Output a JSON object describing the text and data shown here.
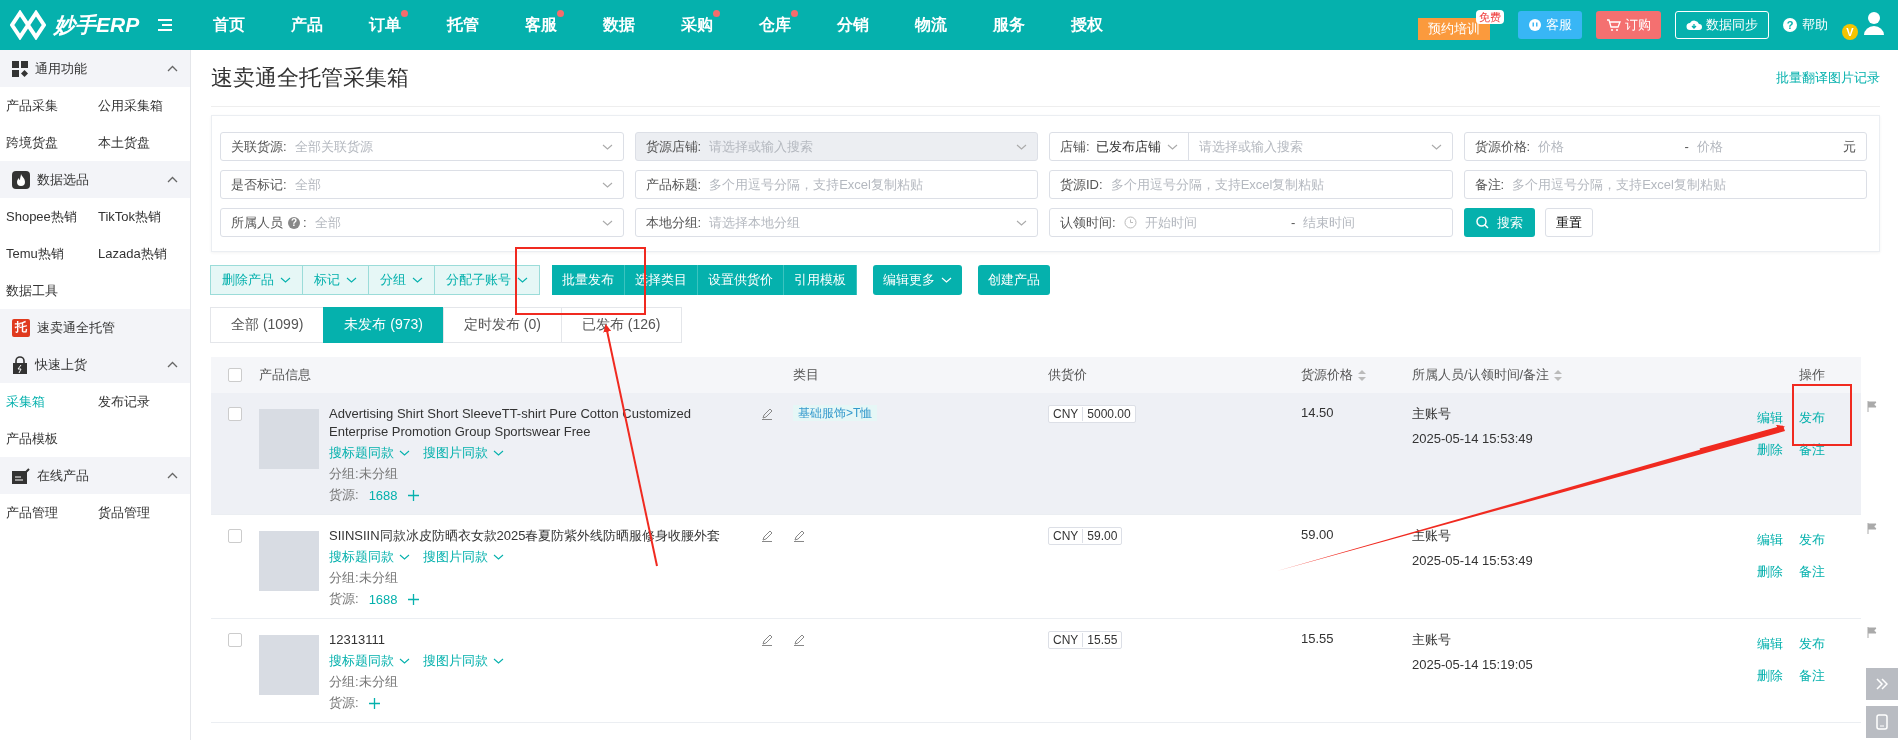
{
  "brand": {
    "name": "妙手ERP"
  },
  "nav": [
    {
      "label": "首页",
      "badge": false
    },
    {
      "label": "产品",
      "badge": false
    },
    {
      "label": "订单",
      "badge": true
    },
    {
      "label": "托管",
      "badge": false
    },
    {
      "label": "客服",
      "badge": true
    },
    {
      "label": "数据",
      "badge": false
    },
    {
      "label": "采购",
      "badge": true
    },
    {
      "label": "仓库",
      "badge": true
    },
    {
      "label": "分销",
      "badge": false
    },
    {
      "label": "物流",
      "badge": false
    },
    {
      "label": "服务",
      "badge": false
    },
    {
      "label": "授权",
      "badge": false
    }
  ],
  "header_actions": [
    {
      "kind": "training",
      "label": "预约培训",
      "tag": "免费"
    },
    {
      "kind": "service",
      "label": "客服"
    },
    {
      "kind": "order",
      "label": "订购"
    },
    {
      "kind": "sync",
      "label": "数据同步"
    },
    {
      "kind": "help",
      "label": "帮助",
      "icon_text": "?"
    }
  ],
  "avatar": {
    "badge": "V"
  },
  "sidebar": [
    {
      "title": "通用功能",
      "expanded": true,
      "items": [
        {
          "label": "产品采集",
          "selected": false
        },
        {
          "label": "公用采集箱",
          "selected": false
        },
        {
          "label": "跨境货盘",
          "selected": false
        },
        {
          "label": "本土货盘",
          "selected": false
        }
      ]
    },
    {
      "title": "数据选品",
      "expanded": true,
      "items": [
        {
          "label": "Shopee热销",
          "selected": false
        },
        {
          "label": "TikTok热销",
          "selected": false
        },
        {
          "label": "Temu热销",
          "selected": false
        },
        {
          "label": "Lazada热销",
          "selected": false
        },
        {
          "label": "数据工具",
          "selected": false
        }
      ]
    },
    {
      "title": "速卖通全托管",
      "badge_text": "托",
      "expanded": false
    },
    {
      "title": "快速上货",
      "expanded": true,
      "items": [
        {
          "label": "采集箱",
          "selected": true
        },
        {
          "label": "发布记录",
          "selected": false
        },
        {
          "label": "产品模板",
          "selected": false
        }
      ]
    },
    {
      "title": "在线产品",
      "expanded": true,
      "items": [
        {
          "label": "产品管理",
          "selected": false
        },
        {
          "label": "货品管理",
          "selected": false
        }
      ]
    }
  ],
  "page": {
    "title": "速卖通全托管采集箱",
    "link": "批量翻译图片记录"
  },
  "filters": [
    {
      "kind": "select",
      "label": "关联货源:",
      "placeholder": "全部关联货源",
      "disabled": false
    },
    {
      "kind": "select",
      "label": "货源店铺:",
      "placeholder": "请选择或输入搜索",
      "disabled": true
    },
    {
      "kind": "split",
      "label": "店铺:",
      "value": "已发布店铺",
      "placeholder": "请选择或输入搜索",
      "disabled": false
    },
    {
      "kind": "range",
      "label": "货源价格:",
      "from": "价格",
      "separator": "-",
      "to": "价格",
      "unit": "元",
      "disabled": false
    },
    {
      "kind": "select",
      "label": "是否标记:",
      "placeholder": "全部",
      "disabled": false
    },
    {
      "kind": "text",
      "label": "产品标题:",
      "placeholder": "多个用逗号分隔，支持Excel复制粘贴",
      "disabled": false
    },
    {
      "kind": "text",
      "label": "货源ID:",
      "placeholder": "多个用逗号分隔，支持Excel复制粘贴",
      "disabled": false
    },
    {
      "kind": "text",
      "label": "备注:",
      "placeholder": "多个用逗号分隔，支持Excel复制粘贴",
      "disabled": false
    },
    {
      "kind": "select",
      "label": "所属人员",
      "hint": "?",
      "suffix": ":",
      "placeholder": "全部",
      "disabled": false
    },
    {
      "kind": "select",
      "label": "本地分组:",
      "placeholder": "请选择本地分组",
      "disabled": false
    },
    {
      "kind": "daterange",
      "label": "认领时间:",
      "from": "开始时间",
      "separator": "-",
      "to": "结束时间",
      "disabled": false
    }
  ],
  "filter_buttons": {
    "search": "搜索",
    "reset": "重置"
  },
  "toolbar": {
    "outline": [
      "删除产品",
      "标记",
      "分组",
      "分配子账号"
    ],
    "primary": [
      "批量发布",
      "选择类目",
      "设置供货价",
      "引用模板"
    ],
    "more": "编辑更多",
    "create": "创建产品"
  },
  "tabs": [
    {
      "label": "全部 (1099)",
      "selected": false
    },
    {
      "label": "未发布 (973)",
      "selected": true
    },
    {
      "label": "定时发布 (0)",
      "selected": false
    },
    {
      "label": "已发布 (126)",
      "selected": false
    }
  ],
  "table": {
    "select_all": {
      "checked": false
    },
    "columns": [
      {
        "label": "产品信息",
        "sortable": false
      },
      {
        "label": "类目",
        "sortable": false
      },
      {
        "label": "供货价",
        "sortable": false
      },
      {
        "label": "货源价格",
        "sortable": true
      },
      {
        "label": "所属人员/认领时间/备注",
        "sortable": true
      },
      {
        "label": "操作",
        "sortable": false
      }
    ],
    "rows": [
      {
        "checked": false,
        "hovered": true,
        "title": "Advertising Shirt Short SleeveTT-shirt Pure Cotton Customized Enterprise Promotion Group Sportswear Free",
        "search_title": "搜标题同款",
        "search_image": "搜图片同款",
        "group_label": "分组:",
        "group": "未分组",
        "source_label": "货源:",
        "source": "1688",
        "category": "基础服饰>T恤",
        "currency": "CNY",
        "price": "5000.00",
        "source_price": "14.50",
        "owner": "主账号",
        "time": "2025-05-14 15:53:49",
        "actions": [
          "编辑",
          "发布",
          "删除",
          "备注"
        ]
      },
      {
        "checked": false,
        "hovered": false,
        "title": "SIINSIIN同款冰皮防晒衣女款2025春夏防紫外线防晒服修身收腰外套",
        "search_title": "搜标题同款",
        "search_image": "搜图片同款",
        "group_label": "分组:",
        "group": "未分组",
        "source_label": "货源:",
        "source": "1688",
        "currency": "CNY",
        "price": "59.00",
        "source_price": "59.00",
        "owner": "主账号",
        "time": "2025-05-14 15:53:49",
        "actions": [
          "编辑",
          "发布",
          "删除",
          "备注"
        ]
      },
      {
        "checked": false,
        "hovered": false,
        "title": "12313111",
        "search_title": "搜标题同款",
        "search_image": "搜图片同款",
        "group_label": "分组:",
        "group": "未分组",
        "source_label": "货源:",
        "currency": "CNY",
        "price": "15.55",
        "source_price": "15.55",
        "owner": "主账号",
        "time": "2025-05-14 15:19:05",
        "actions": [
          "编辑",
          "发布",
          "删除",
          "备注"
        ]
      }
    ]
  }
}
